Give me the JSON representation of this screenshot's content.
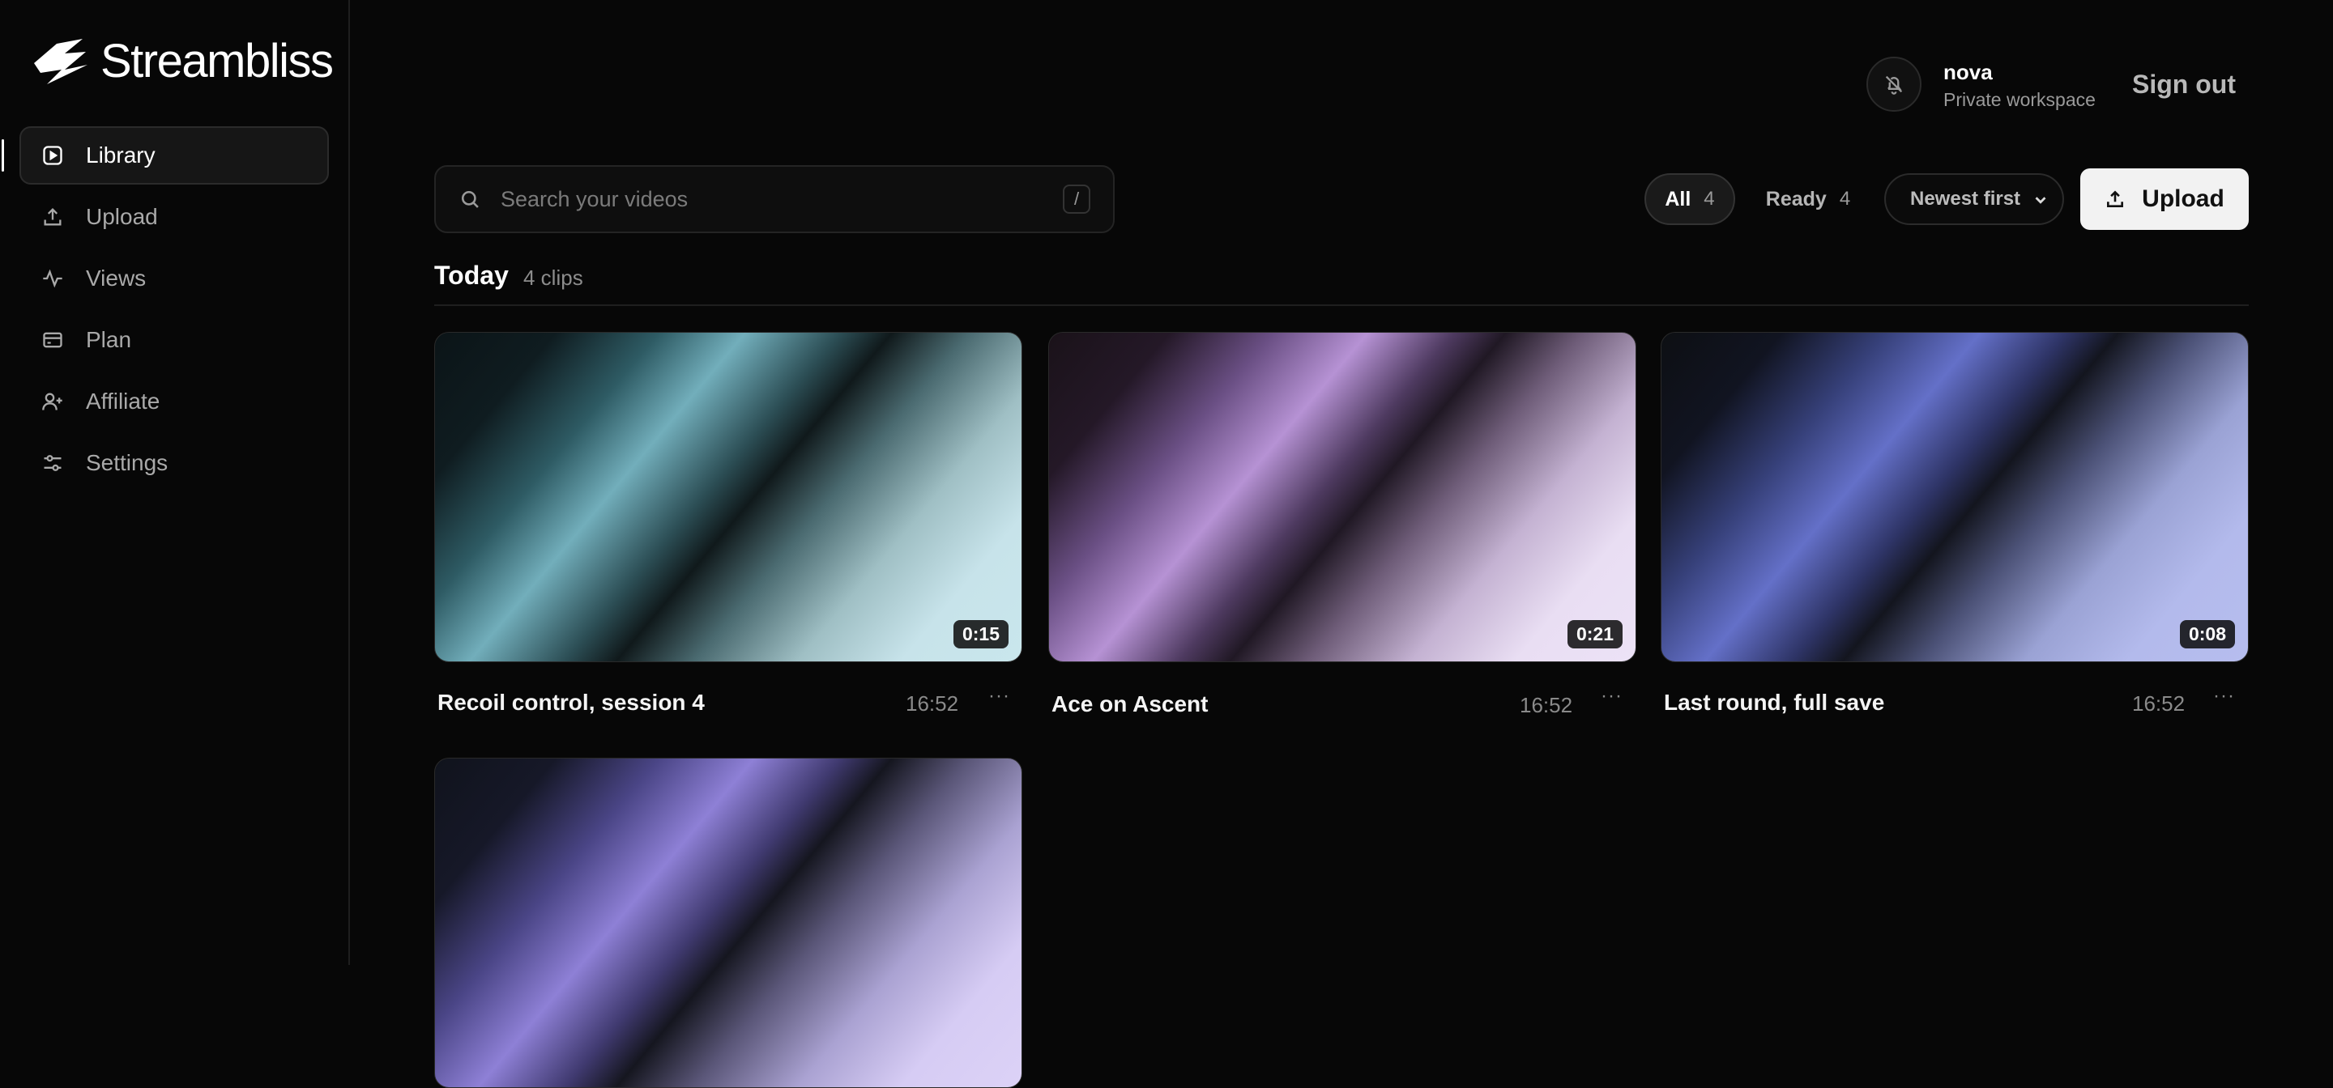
{
  "app": {
    "name": "Streambliss"
  },
  "sidebar": {
    "items": [
      {
        "label": "Library",
        "icon": "play-square-icon",
        "active": true
      },
      {
        "label": "Upload",
        "icon": "upload-icon",
        "active": false
      },
      {
        "label": "Views",
        "icon": "activity-icon",
        "active": false
      },
      {
        "label": "Plan",
        "icon": "credit-card-icon",
        "active": false
      },
      {
        "label": "Affiliate",
        "icon": "user-plus-icon",
        "active": false
      },
      {
        "label": "Settings",
        "icon": "sliders-icon",
        "active": false
      }
    ]
  },
  "header": {
    "user_name": "nova",
    "workspace": "Private workspace",
    "sign_out": "Sign out",
    "notification_icon": "bell-off-icon"
  },
  "toolbar": {
    "search_placeholder": "Search your videos",
    "search_value": "",
    "search_shortcut": "/",
    "filters": [
      {
        "label": "All",
        "count": "4",
        "selected": true
      },
      {
        "label": "Ready",
        "count": "4",
        "selected": false
      }
    ],
    "sort_selected": "Newest first",
    "upload_label": "Upload"
  },
  "section": {
    "title": "Today",
    "count_label": "4 clips"
  },
  "videos": [
    {
      "title": "Recoil control, session 4",
      "time": "16:52",
      "duration": "0:15",
      "more": "···",
      "accent": "#72aebb"
    },
    {
      "title": "Ace on Ascent",
      "time": "16:52",
      "duration": "0:21",
      "more": "···",
      "accent": "#b692d4"
    },
    {
      "title": "Last round, full save",
      "time": "16:52",
      "duration": "0:08",
      "more": "···",
      "accent": "#6470c8"
    },
    {
      "title": "",
      "time": "",
      "duration": "",
      "more": "",
      "accent": "#8e80d6"
    }
  ],
  "colors": {
    "background": "#070707",
    "sidebar_border": "#1e1e1e",
    "upload_button_bg": "#f2f2f2"
  }
}
